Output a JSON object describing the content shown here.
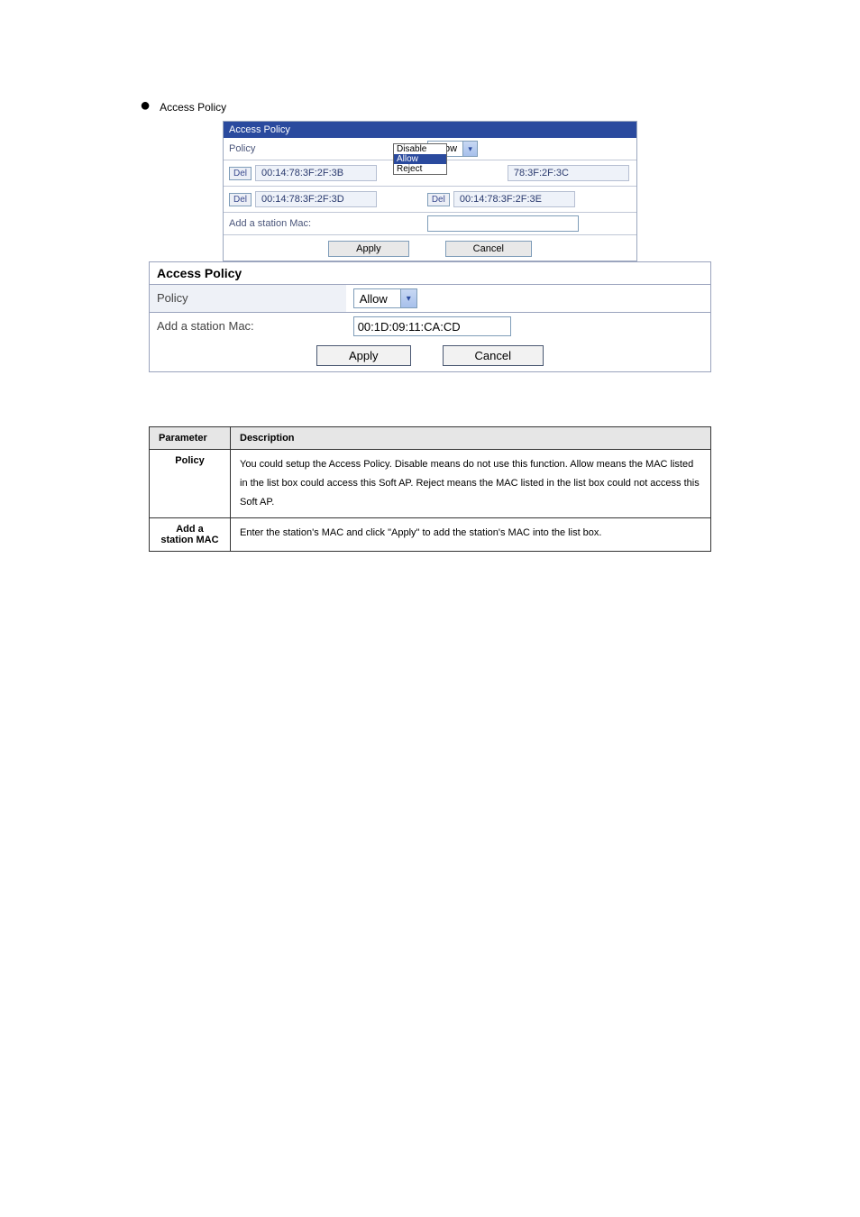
{
  "bullet": {
    "text": "Access Policy"
  },
  "panel1": {
    "header": "Access Policy",
    "policyLabel": "Policy",
    "policyValue": "Allow",
    "dropdown": {
      "opt1": "Disable",
      "opt2": "Allow",
      "opt3": "Reject"
    },
    "del": "Del",
    "mac1": "00:14:78:3F:2F:3B",
    "mac2": "78:3F:2F:3C",
    "mac3": "00:14:78:3F:2F:3D",
    "mac4": "00:14:78:3F:2F:3E",
    "addLabel": "Add a station Mac:",
    "addValue": "",
    "apply": "Apply",
    "cancel": "Cancel"
  },
  "panel2": {
    "header": "Access Policy",
    "policyLabel": "Policy",
    "policyValue": "Allow",
    "addLabel": "Add a station Mac:",
    "addValue": "00:1D:09:11:CA:CD",
    "apply": "Apply",
    "cancel": "Cancel"
  },
  "descTable": {
    "h1": "Parameter",
    "h2": "Description",
    "r1p": "Policy",
    "r1d": "You could setup the Access Policy. Disable means do not use this function. Allow means the MAC listed in the list box could access this Soft AP. Reject means the MAC listed in the list box could not access this Soft AP.",
    "r2p": "Add a station MAC",
    "r2d": "Enter the station's MAC and click \"Apply\" to add the station's MAC into the list box."
  }
}
